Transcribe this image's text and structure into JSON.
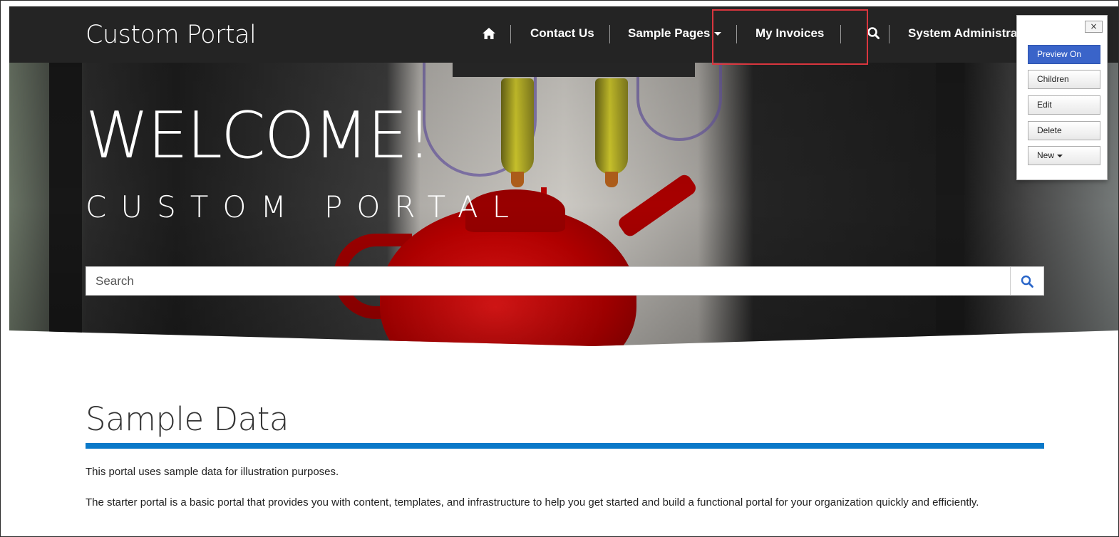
{
  "navbar": {
    "brand": "Custom Portal",
    "items": [
      {
        "label": "Contact Us"
      },
      {
        "label": "Sample Pages"
      },
      {
        "label": "My Invoices"
      },
      {
        "label": "System Administrat"
      }
    ]
  },
  "hero": {
    "welcome": "WELCOME!",
    "subtitle": "CUSTOM PORTAL",
    "search_placeholder": "Search"
  },
  "content": {
    "section_title": "Sample Data",
    "para1": "This portal uses sample data for illustration purposes.",
    "para2": "The starter portal is a basic portal that provides you with content, templates, and infrastructure to help you get started and build a functional portal for your organization quickly and efficiently."
  },
  "edit_panel": {
    "close_label": "×",
    "buttons": [
      {
        "label": "Preview On"
      },
      {
        "label": "Children"
      },
      {
        "label": "Edit"
      },
      {
        "label": "Delete"
      },
      {
        "label": "New"
      }
    ]
  },
  "colors": {
    "navbar_bg": "#242424",
    "accent_rule": "#0a79c9",
    "highlight_box": "#d9363e",
    "preview_button": "#3a64c9"
  }
}
